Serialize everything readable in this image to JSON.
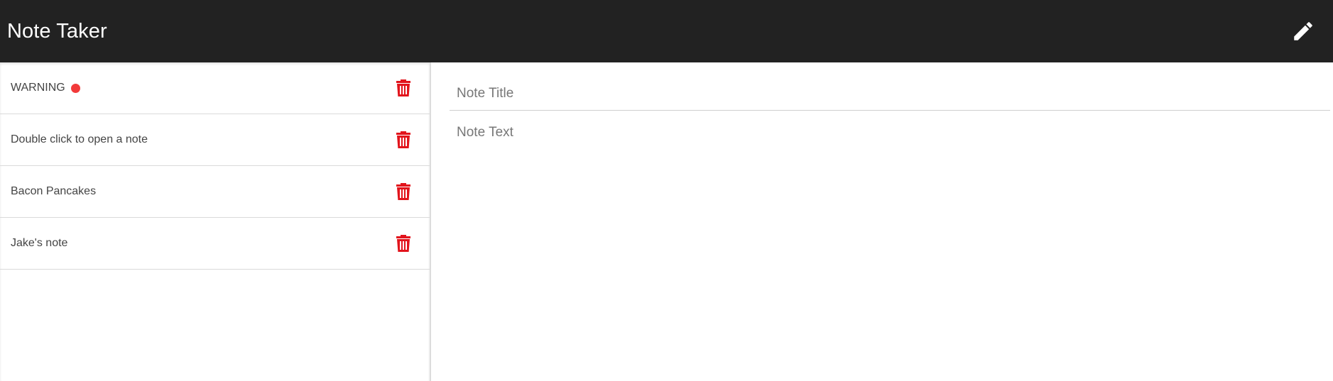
{
  "app": {
    "title": "Note Taker",
    "new_note_icon": "pencil-icon"
  },
  "colors": {
    "navbar_bg": "#222222",
    "delete_icon": "#e2141c",
    "warning_dot": "#f23a3a"
  },
  "notes": [
    {
      "title": "WARNING",
      "has_status_dot": true,
      "delete_icon": "trash-icon"
    },
    {
      "title": "Double click to open a note",
      "has_status_dot": false,
      "delete_icon": "trash-icon"
    },
    {
      "title": "Bacon Pancakes",
      "has_status_dot": false,
      "delete_icon": "trash-icon"
    },
    {
      "title": "Jake's note",
      "has_status_dot": false,
      "delete_icon": "trash-icon"
    }
  ],
  "editor": {
    "title_value": "",
    "title_placeholder": "Note Title",
    "text_value": "",
    "text_placeholder": "Note Text"
  }
}
